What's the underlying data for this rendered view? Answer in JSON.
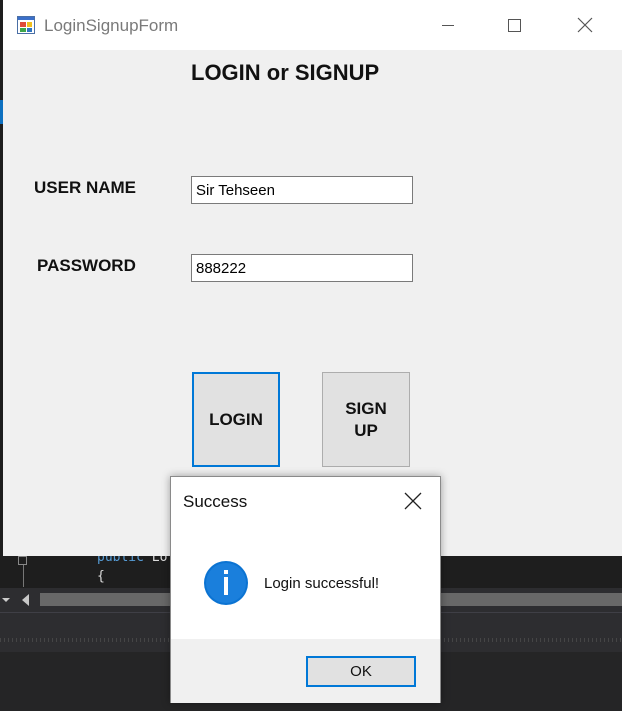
{
  "window": {
    "title": "LoginSignupForm",
    "heading": "LOGIN or SIGNUP",
    "username_label": "USER NAME",
    "password_label": "PASSWORD",
    "username_value": "Sir Tehseen",
    "password_value": "888222",
    "login_button": "LOGIN",
    "signup_button": "SIGN UP"
  },
  "dialog": {
    "title": "Success",
    "message": "Login successful!",
    "ok_button": "OK",
    "icon": "info-icon"
  },
  "background_ide": {
    "code_keyword": "public",
    "code_rest": " Lo",
    "code_brace": "{"
  },
  "colors": {
    "accent": "#0078d7",
    "info_icon": "#0b73d2",
    "form_bg": "#f0f0f0",
    "ide_bg": "#1e1e1e"
  }
}
